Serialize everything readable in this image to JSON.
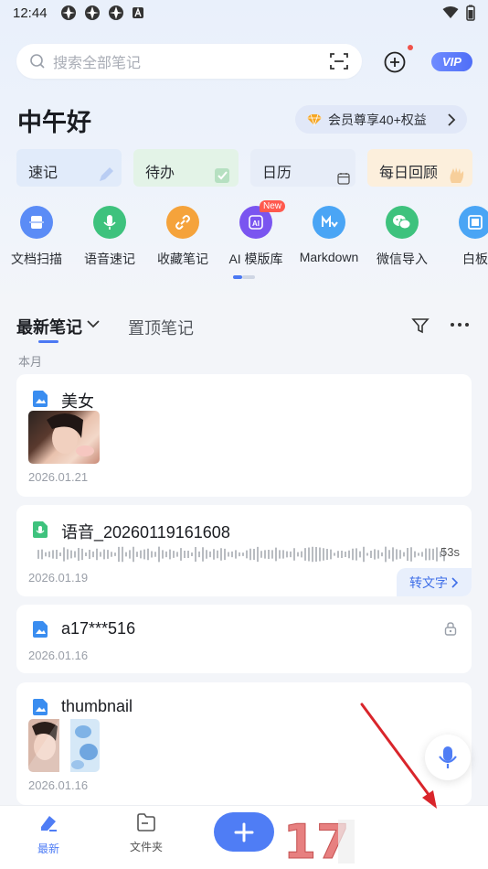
{
  "status_bar": {
    "time": "12:44"
  },
  "search": {
    "placeholder": "搜索全部笔记"
  },
  "header": {
    "vip_label": "VIP"
  },
  "greeting": "中午好",
  "member_promo": {
    "text": "会员尊享40+权益"
  },
  "quick_cards": [
    {
      "label": "速记"
    },
    {
      "label": "待办"
    },
    {
      "label": "日历"
    },
    {
      "label": "每日回顾"
    }
  ],
  "tools": [
    {
      "label": "文档扫描",
      "icon": "scan-doc-icon",
      "color": "#5b8cf6"
    },
    {
      "label": "语音速记",
      "icon": "mic-icon",
      "color": "#3ec27d"
    },
    {
      "label": "收藏笔记",
      "icon": "link-icon",
      "color": "#f5a33b"
    },
    {
      "label": "AI 模版库",
      "icon": "ai-icon",
      "color": "#7a55f0",
      "badge": "New"
    },
    {
      "label": "Markdown",
      "icon": "markdown-icon",
      "color": "#4aa5f5"
    },
    {
      "label": "微信导入",
      "icon": "wechat-icon",
      "color": "#3ec27d"
    },
    {
      "label": "白板",
      "icon": "whiteboard-icon",
      "color": "#4aa5f5"
    }
  ],
  "tabs": {
    "latest": "最新笔记",
    "pinned": "置顶笔记"
  },
  "month_label": "本月",
  "notes": [
    {
      "title": "美女",
      "date": "2026.01.21",
      "type": "image"
    },
    {
      "title": "语音_20260119161608",
      "date": "2026.01.19",
      "type": "audio",
      "duration": "53s",
      "action": "转文字"
    },
    {
      "title": "a17***516",
      "date": "2026.01.16",
      "type": "image",
      "locked": true
    },
    {
      "title": "thumbnail",
      "date": "2026.01.16",
      "type": "image"
    }
  ],
  "bottom_nav": {
    "latest": "最新",
    "folders": "文件夹"
  },
  "colors": {
    "accent": "#4f7df5",
    "arrow": "#d9252b"
  }
}
